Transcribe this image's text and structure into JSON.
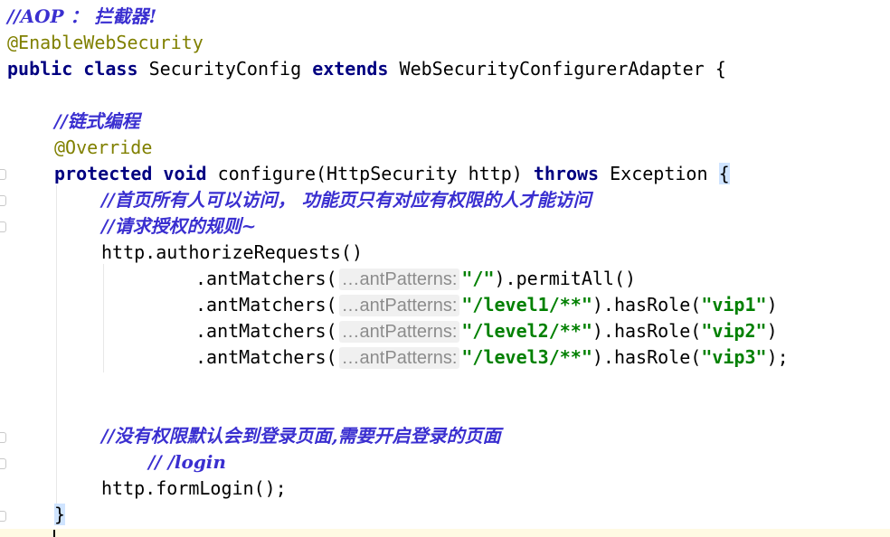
{
  "editor": {
    "lines": {
      "l1": "//AOP ： 拦截器!",
      "l2": "@EnableWebSecurity",
      "l3_kw1": "public",
      "l3_kw2": "class",
      "l3_name": "SecurityConfig",
      "l3_kw3": "extends",
      "l3_parent": "WebSecurityConfigurerAdapter {",
      "l5": "//链式编程",
      "l6": "@Override",
      "l7_kw1": "protected",
      "l7_kw2": "void",
      "l7_sig": "configure(HttpSecurity http)",
      "l7_kw3": "throws",
      "l7_exc": "Exception",
      "l7_brace": "{",
      "l8": "//首页所有人可以访问， 功能页只有对应有权限的人才能访问",
      "l9": "//请求授权的规则~",
      "l10": "http.authorizeRequests()",
      "l11_call": ".antMatchers(",
      "l11_hint": "…antPatterns:",
      "l11_str": "\"/\"",
      "l11_rest": ").permitAll()",
      "l12_call": ".antMatchers(",
      "l12_hint": "…antPatterns:",
      "l12_str": "\"/level1/**\"",
      "l12_mid": ").hasRole(",
      "l12_role": "\"vip1\"",
      "l12_end": ")",
      "l13_call": ".antMatchers(",
      "l13_hint": "…antPatterns:",
      "l13_str": "\"/level2/**\"",
      "l13_mid": ").hasRole(",
      "l13_role": "\"vip2\"",
      "l13_end": ")",
      "l14_call": ".antMatchers(",
      "l14_hint": "…antPatterns:",
      "l14_str": "\"/level3/**\"",
      "l14_mid": ").hasRole(",
      "l14_role": "\"vip3\"",
      "l14_end": ");",
      "l17": "//没有权限默认会到登录页面,需要开启登录的页面",
      "l18": "// /login",
      "l19": "http.formLogin();",
      "l20": "}"
    }
  }
}
